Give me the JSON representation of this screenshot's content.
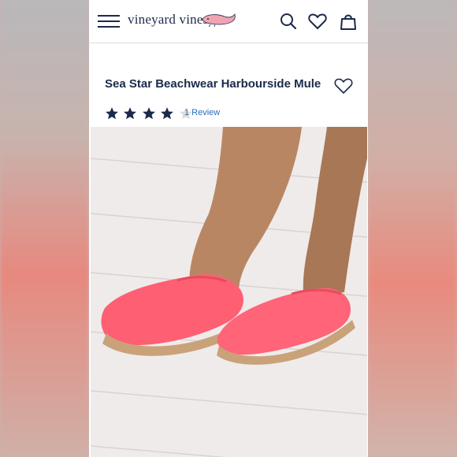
{
  "header": {
    "brand": "vineyard vines",
    "icons": [
      "menu-icon",
      "whale-logo-icon",
      "search-icon",
      "heart-icon",
      "shopping-bag-icon"
    ]
  },
  "product": {
    "title": "Sea Star Beachwear Harbourside Mule",
    "rating": 4,
    "rating_max": 5,
    "review_text": "1 Review",
    "image_alt": "Pink espadrille mules on feet"
  },
  "colors": {
    "navy": "#1b2a4a",
    "link": "#2a6ebd",
    "star_empty": "#dcdcdc",
    "whale_pink": "#f0a3b1",
    "shoe_pink": "#ff5f73"
  }
}
